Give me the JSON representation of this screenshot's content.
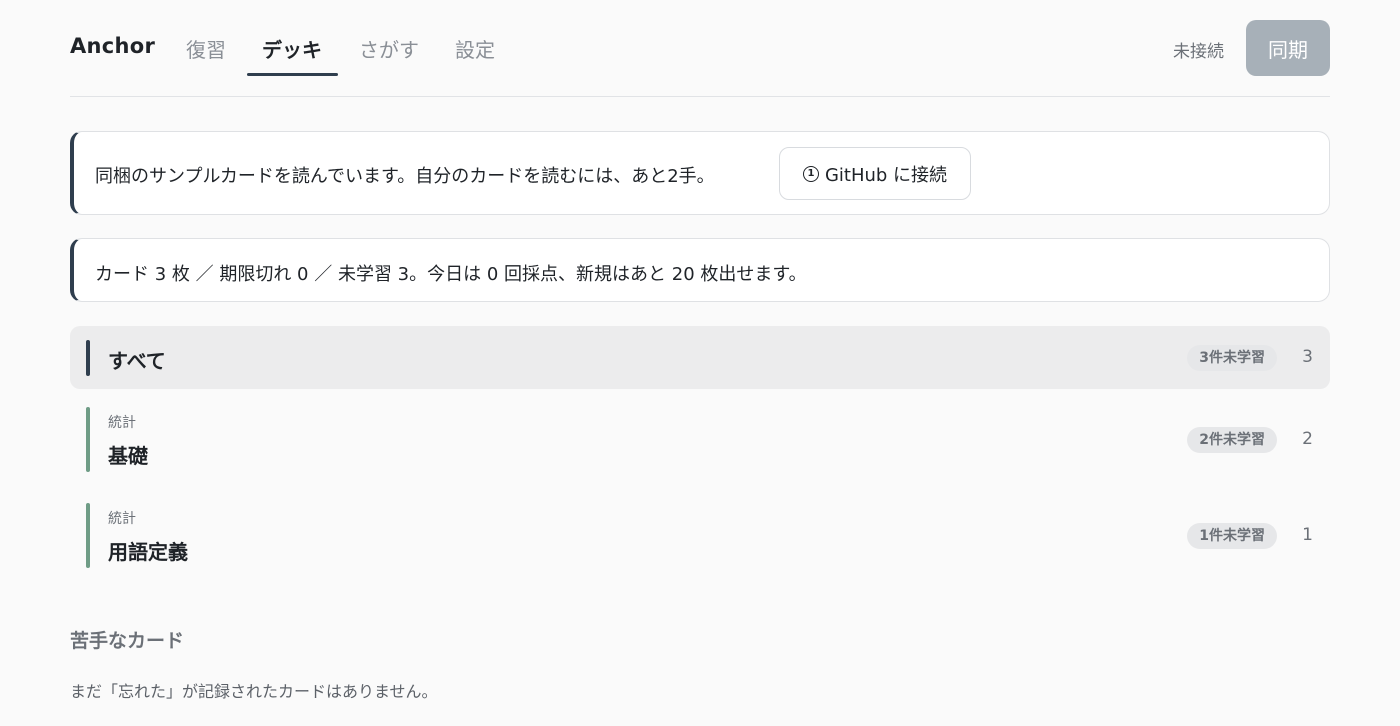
{
  "header": {
    "brand": "Anchor",
    "tabs": [
      {
        "label": "復習",
        "active": false
      },
      {
        "label": "デッキ",
        "active": true
      },
      {
        "label": "さがす",
        "active": false
      },
      {
        "label": "設定",
        "active": false
      }
    ],
    "connection_status": "未接続",
    "sync_label": "同期"
  },
  "banners": {
    "sample_notice": "同梱のサンプルカードを読んでいます。自分のカードを読むには、あと2手。",
    "connect_button": {
      "step_icon": "①",
      "label": "GitHub に接続"
    },
    "summary": "カード 3 枚 ／ 期限切れ 0 ／ 未学習 3。今日は 0 回採点、新規はあと 20 枚出せます。"
  },
  "decks": {
    "all": {
      "title": "すべて",
      "badge": "3件未学習",
      "count": "3"
    },
    "items": [
      {
        "category": "統計",
        "name": "基礎",
        "badge": "2件未学習",
        "count": "2"
      },
      {
        "category": "統計",
        "name": "用語定義",
        "badge": "1件未学習",
        "count": "1"
      }
    ]
  },
  "weak_cards": {
    "heading": "苦手なカード",
    "empty_message": "まだ「忘れた」が記録されたカードはありません。"
  },
  "colors": {
    "accent": "#2f3e4e",
    "deck_bar": "#6f9c86",
    "sync_disabled": "#a7b0b8"
  }
}
